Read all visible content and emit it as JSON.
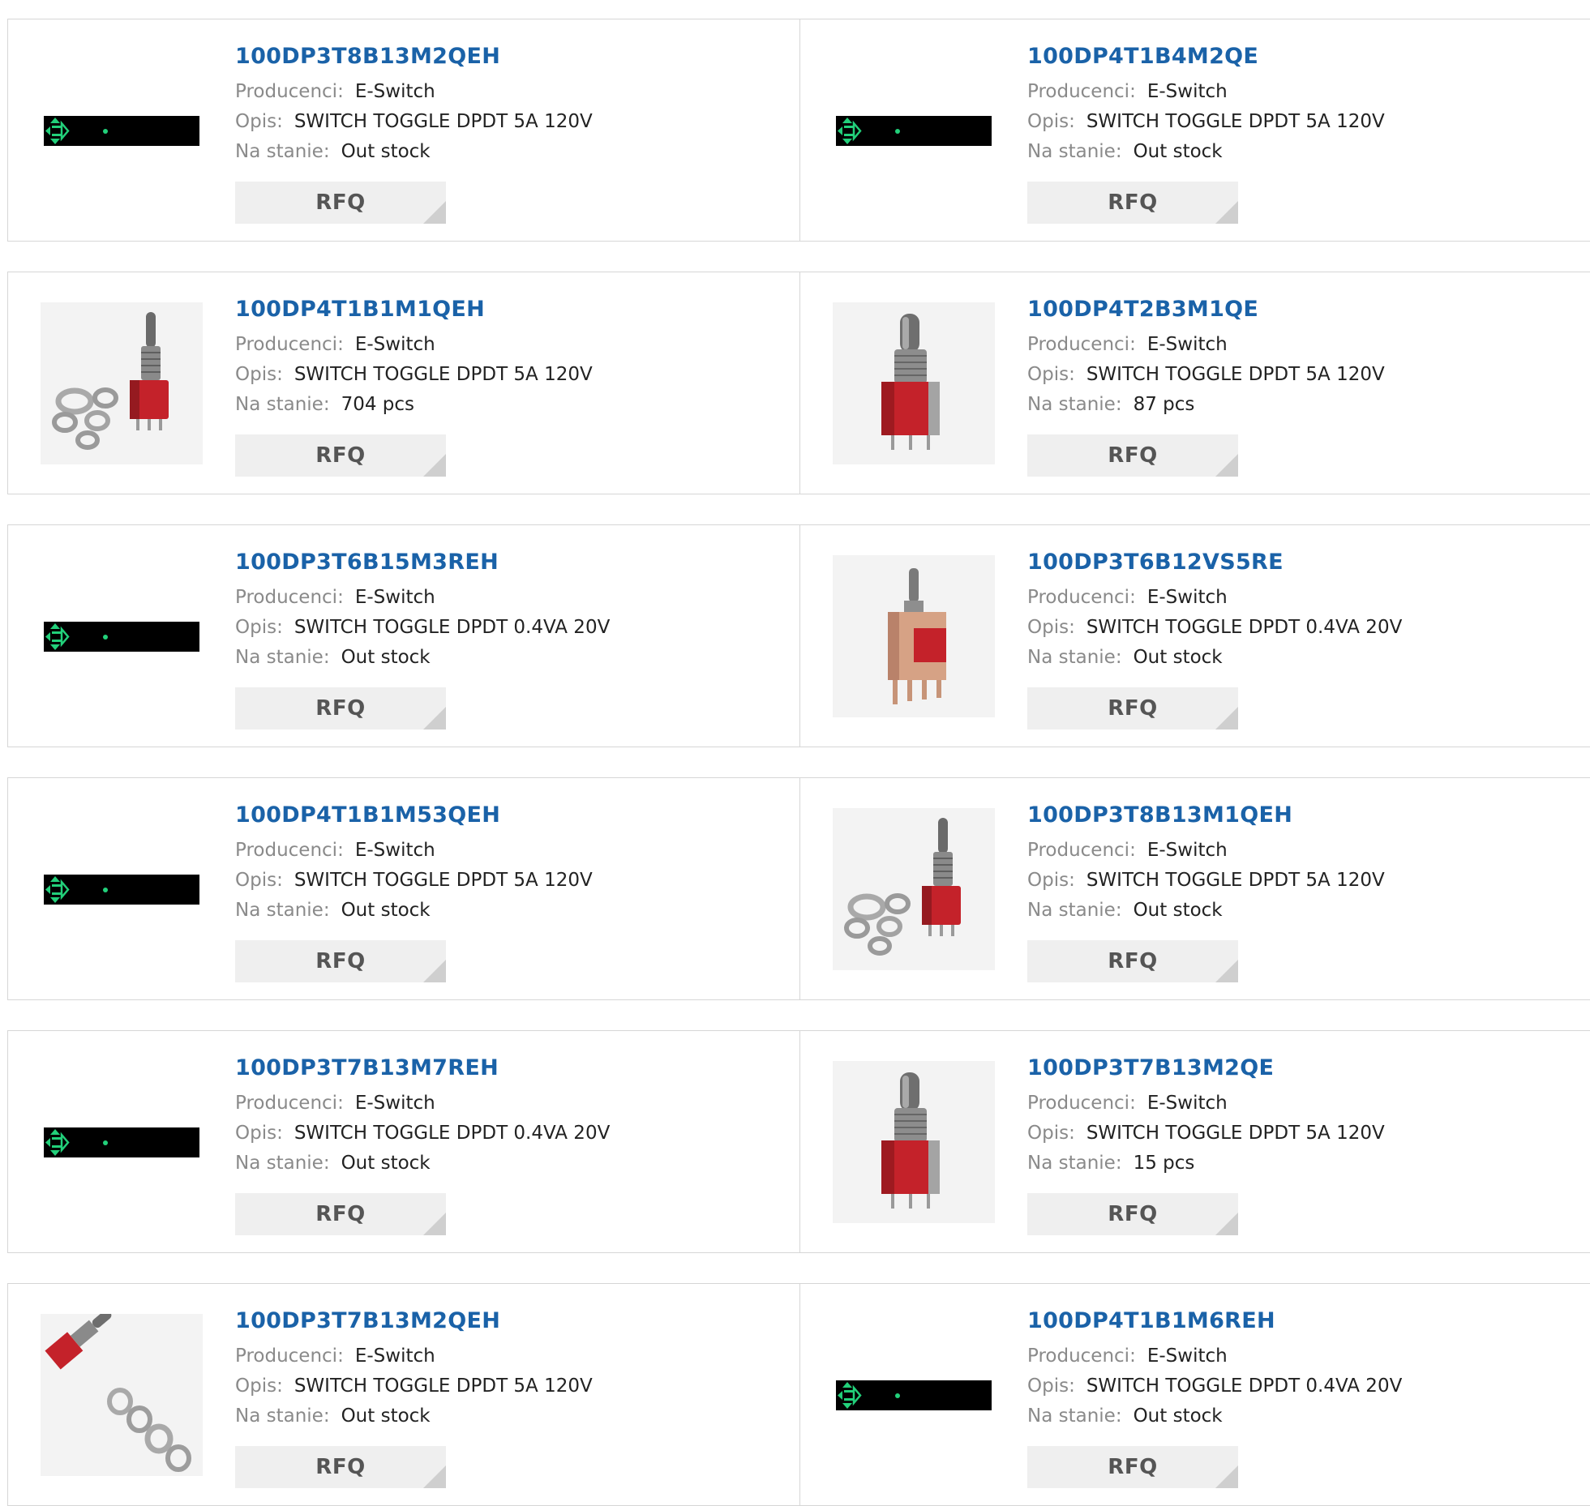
{
  "labels": {
    "manufacturer": "Producenci:",
    "description": "Opis:",
    "stock": "Na stanie:",
    "rfq": "RFQ"
  },
  "colors": {
    "part_link": "#1a62a8",
    "placeholder_bar": "#000000",
    "placeholder_glyph": "#22d07a",
    "rfq_bg": "#efefef"
  },
  "products": [
    {
      "part": "100DP3T8B13M2QEH",
      "manufacturer": "E-Switch",
      "description": "SWITCH TOGGLE DPDT 5A 120V",
      "stock": "Out stock",
      "image": "placeholder-icon"
    },
    {
      "part": "100DP4T1B4M2QE",
      "manufacturer": "E-Switch",
      "description": "SWITCH TOGGLE DPDT 5A 120V",
      "stock": "Out stock",
      "image": "placeholder-icon"
    },
    {
      "part": "100DP4T1B1M1QEH",
      "manufacturer": "E-Switch",
      "description": "SWITCH TOGGLE DPDT 5A 120V",
      "stock": "704 pcs",
      "image": "toggle-switch-with-washers"
    },
    {
      "part": "100DP4T2B3M1QE",
      "manufacturer": "E-Switch",
      "description": "SWITCH TOGGLE DPDT 5A 120V",
      "stock": "87 pcs",
      "image": "toggle-switch"
    },
    {
      "part": "100DP3T6B15M3REH",
      "manufacturer": "E-Switch",
      "description": "SWITCH TOGGLE DPDT 0.4VA 20V",
      "stock": "Out stock",
      "image": "placeholder-icon"
    },
    {
      "part": "100DP3T6B12VS5RE",
      "manufacturer": "E-Switch",
      "description": "SWITCH TOGGLE DPDT 0.4VA 20V",
      "stock": "Out stock",
      "image": "toggle-switch-bracket"
    },
    {
      "part": "100DP4T1B1M53QEH",
      "manufacturer": "E-Switch",
      "description": "SWITCH TOGGLE DPDT 5A 120V",
      "stock": "Out stock",
      "image": "placeholder-icon"
    },
    {
      "part": "100DP3T8B13M1QEH",
      "manufacturer": "E-Switch",
      "description": "SWITCH TOGGLE DPDT 5A 120V",
      "stock": "Out stock",
      "image": "toggle-switch-with-washers"
    },
    {
      "part": "100DP3T7B13M7REH",
      "manufacturer": "E-Switch",
      "description": "SWITCH TOGGLE DPDT 0.4VA 20V",
      "stock": "Out stock",
      "image": "placeholder-icon"
    },
    {
      "part": "100DP3T7B13M2QE",
      "manufacturer": "E-Switch",
      "description": "SWITCH TOGGLE DPDT 5A 120V",
      "stock": "15 pcs",
      "image": "toggle-switch"
    },
    {
      "part": "100DP3T7B13M2QEH",
      "manufacturer": "E-Switch",
      "description": "SWITCH TOGGLE DPDT 5A 120V",
      "stock": "Out stock",
      "image": "toggle-switch-angled-washers"
    },
    {
      "part": "100DP4T1B1M6REH",
      "manufacturer": "E-Switch",
      "description": "SWITCH TOGGLE DPDT 0.4VA 20V",
      "stock": "Out stock",
      "image": "placeholder-icon"
    }
  ]
}
